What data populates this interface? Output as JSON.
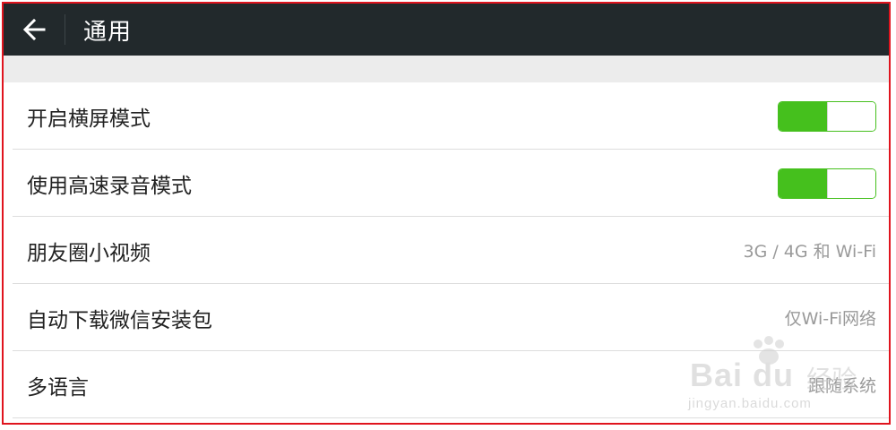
{
  "header": {
    "back_icon": "back-arrow-icon",
    "title": "通用"
  },
  "colors": {
    "header_bg": "#22292c",
    "toggle_on": "#45c01d",
    "annotation_border": "#e0141e"
  },
  "settings": [
    {
      "label": "开启横屏模式",
      "type": "toggle",
      "checked": true
    },
    {
      "label": "使用高速录音模式",
      "type": "toggle",
      "checked": true
    },
    {
      "label": "朋友圈小视频",
      "type": "value",
      "value": "3G / 4G 和 Wi-Fi"
    },
    {
      "label": "自动下载微信安装包",
      "type": "value",
      "value": "仅Wi-Fi网络"
    },
    {
      "label": "多语言",
      "type": "value",
      "value": "跟随系统"
    }
  ],
  "watermark": {
    "brand": "Bai du",
    "brand_cn": "经验",
    "url": "jingyan.baidu.com"
  }
}
